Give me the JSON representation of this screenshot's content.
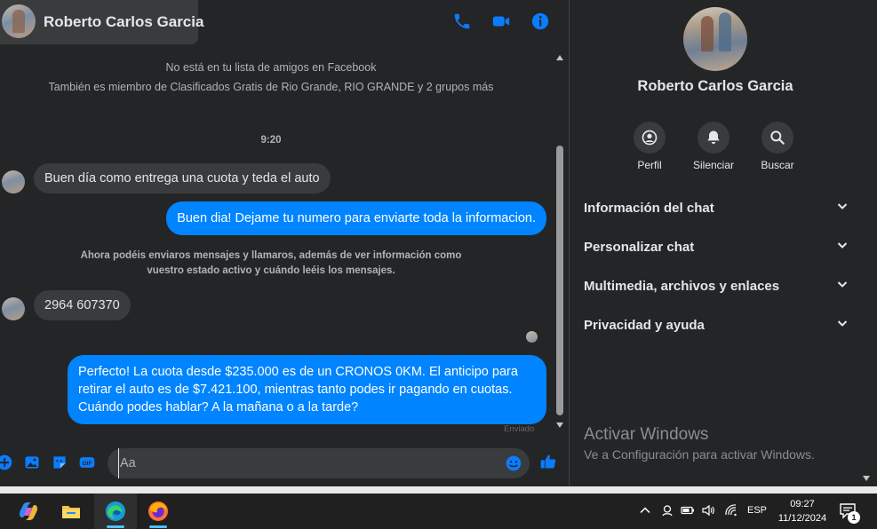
{
  "header": {
    "contact_name": "Roberto Carlos Garcia",
    "icons": [
      "phone-icon",
      "video-icon",
      "info-icon"
    ]
  },
  "conversation": {
    "notice_line1": "No está en tu lista de amigos en Facebook",
    "notice_line2": "También es miembro de Clasificados Gratis de Rio Grande, RIO GRANDE y 2 grupos más",
    "timestamp": "9:20",
    "messages": [
      {
        "direction": "in",
        "text": "Buen día como entrega una cuota y teda el auto"
      },
      {
        "direction": "out",
        "text": "Buen dia! Dejame tu numero para enviarte toda la informacion."
      },
      {
        "direction": "in",
        "text": "2964 607370"
      },
      {
        "direction": "out",
        "text": "Perfecto! La cuota desde $235.000 es de un CRONOS 0KM. El anticipo para retirar el auto es de $7.421.100, mientras tanto podes ir pagando en cuotas. Cuándo podes hablar? A la mañana o a la tarde?"
      }
    ],
    "system_notice_line1": "Ahora podéis enviaros mensajes y llamaros, además de ver información como",
    "system_notice_line2": "vuestro estado activo y cuándo leéis los mensajes.",
    "sent_status": "Enviado"
  },
  "composer": {
    "placeholder": "Aa",
    "icons": [
      "plus-icon",
      "image-icon",
      "sticker-icon",
      "gif-icon",
      "emoji-icon",
      "like-icon"
    ],
    "gif_label": "GIF"
  },
  "info_panel": {
    "name": "Roberto Carlos Garcia",
    "actions": [
      {
        "label": "Perfil",
        "icon": "profile-icon"
      },
      {
        "label": "Silenciar",
        "icon": "bell-icon"
      },
      {
        "label": "Buscar",
        "icon": "search-icon"
      }
    ],
    "sections": [
      "Información del chat",
      "Personalizar chat",
      "Multimedia, archivos y enlaces",
      "Privacidad y ayuda"
    ]
  },
  "watermark": {
    "title": "Activar Windows",
    "subtitle": "Ve a Configuración para activar Windows."
  },
  "taskbar": {
    "apps": [
      "copilot-icon",
      "file-explorer-icon",
      "edge-icon",
      "firefox-icon"
    ],
    "tray_language": "ESP",
    "time": "09:27",
    "date": "11/12/2024",
    "notification_count": "1"
  },
  "colors": {
    "accent": "#0084ff",
    "background": "#242526",
    "bubble_in": "#3a3b3c"
  }
}
